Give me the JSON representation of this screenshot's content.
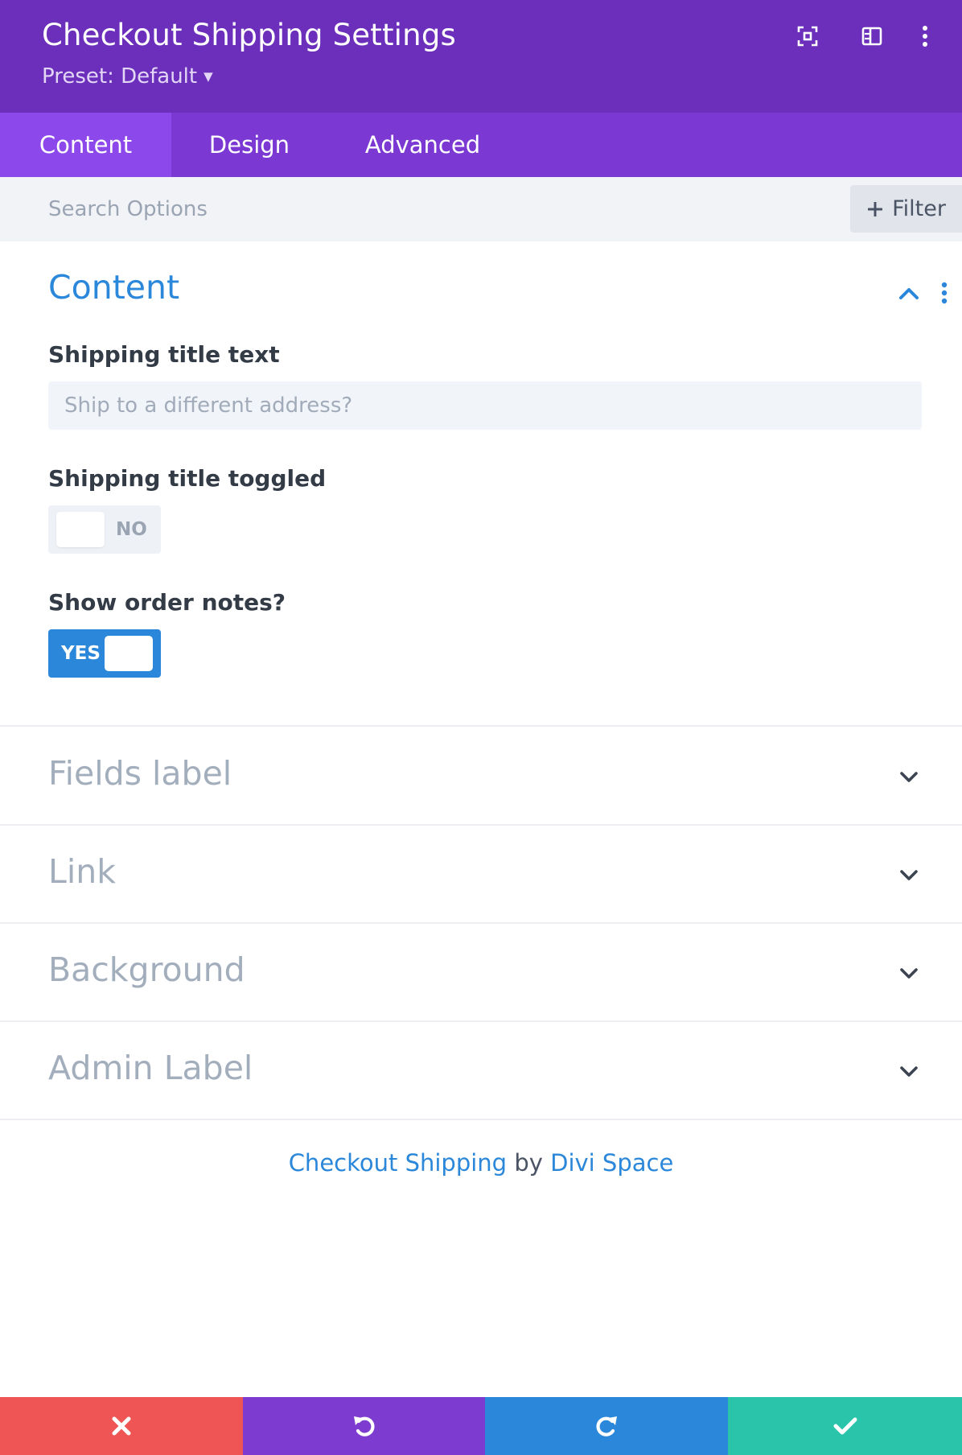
{
  "header": {
    "title": "Checkout Shipping Settings",
    "preset_label": "Preset: Default"
  },
  "header_icons": [
    "expand-icon",
    "split-view-icon",
    "more-vertical-icon"
  ],
  "tabs": [
    {
      "label": "Content",
      "active": true
    },
    {
      "label": "Design",
      "active": false
    },
    {
      "label": "Advanced",
      "active": false
    }
  ],
  "search": {
    "placeholder": "Search Options",
    "filter_label": "Filter"
  },
  "content_section": {
    "title": "Content",
    "expanded": true,
    "fields": {
      "shipping_title_text": {
        "label": "Shipping title text",
        "placeholder": "Ship to a different address?",
        "value": ""
      },
      "shipping_title_toggled": {
        "label": "Shipping title toggled",
        "state_text": "NO",
        "value": false
      },
      "show_order_notes": {
        "label": "Show order notes?",
        "state_text": "YES",
        "value": true
      }
    }
  },
  "collapsed_sections": [
    {
      "title": "Fields label"
    },
    {
      "title": "Link"
    },
    {
      "title": "Background"
    },
    {
      "title": "Admin Label"
    }
  ],
  "credit": {
    "module_link": "Checkout Shipping",
    "by": "by",
    "author_link": "Divi Space"
  },
  "footer": {
    "buttons": [
      "discard",
      "undo",
      "redo",
      "save"
    ],
    "colors": {
      "discard": "#ef5555",
      "undo": "#7e3bd0",
      "redo": "#2b87da",
      "save": "#29c4a9"
    }
  },
  "colors": {
    "header_bg": "#6b2fbb",
    "tabs_bg": "#7b38d3",
    "active_tab_bg": "#8c48ea",
    "accent_blue": "#2b87da"
  }
}
